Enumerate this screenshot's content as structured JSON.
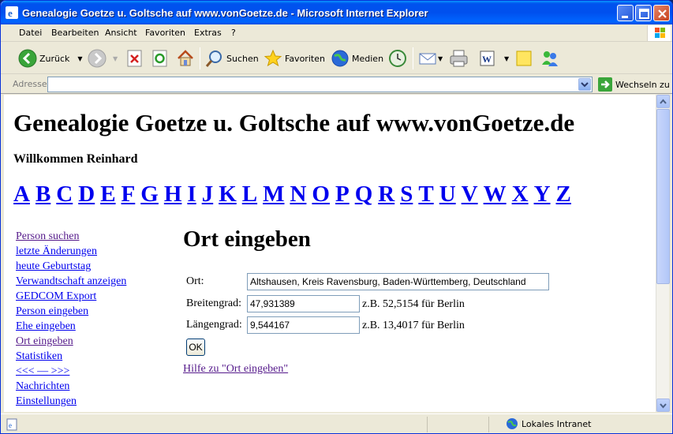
{
  "window": {
    "title": "Genealogie Goetze u. Goltsche auf www.vonGoetze.de - Microsoft Internet Explorer"
  },
  "menu": {
    "items": [
      "Datei",
      "Bearbeiten",
      "Ansicht",
      "Favoriten",
      "Extras",
      "?"
    ]
  },
  "toolbar": {
    "back_label": "Zurück",
    "search_label": "Suchen",
    "favorites_label": "Favoriten",
    "media_label": "Medien"
  },
  "address": {
    "label": "Adresse",
    "value": "",
    "go_label": "Wechseln zu"
  },
  "page": {
    "site_title": "Genealogie Goetze u. Goltsche auf www.vonGoetze.de",
    "welcome": "Willkommen Reinhard",
    "alphabet": [
      "A",
      "B",
      "C",
      "D",
      "E",
      "F",
      "G",
      "H",
      "I",
      "J",
      "K",
      "L",
      "M",
      "N",
      "O",
      "P",
      "Q",
      "R",
      "S",
      "T",
      "U",
      "V",
      "W",
      "X",
      "Y",
      "Z"
    ],
    "nav": [
      {
        "label": "Person suchen",
        "visited": true
      },
      {
        "label": "letzte Änderungen",
        "visited": false
      },
      {
        "label": "heute Geburtstag",
        "visited": false
      },
      {
        "label": "Verwandtschaft anzeigen",
        "visited": false
      },
      {
        "label": "GEDCOM Export",
        "visited": false
      },
      {
        "label": "Person eingeben",
        "visited": false
      },
      {
        "label": "Ehe eingeben",
        "visited": false
      },
      {
        "label": "Ort eingeben",
        "visited": true
      },
      {
        "label": "Statistiken",
        "visited": false
      },
      {
        "label": "<<< — >>>",
        "visited": false
      },
      {
        "label": "Nachrichten",
        "visited": false
      },
      {
        "label": "Einstellungen",
        "visited": false
      }
    ],
    "form_title": "Ort eingeben",
    "ort_label": "Ort:",
    "ort_value": "Altshausen, Kreis Ravensburg, Baden-Württemberg, Deutschland",
    "lat_label": "Breitengrad:",
    "lat_value": "47,931389",
    "lat_hint": "z.B. 52,5154 für Berlin",
    "lon_label": "Längengrad:",
    "lon_value": "9,544167",
    "lon_hint": "z.B. 13,4017 für Berlin",
    "ok_label": "OK",
    "help_link": "Hilfe zu \"Ort eingeben\""
  },
  "status": {
    "zone": "Lokales Intranet"
  },
  "colors": {
    "link": "#0000ee",
    "visited": "#551a8b",
    "titlebar": "#0053ee"
  }
}
